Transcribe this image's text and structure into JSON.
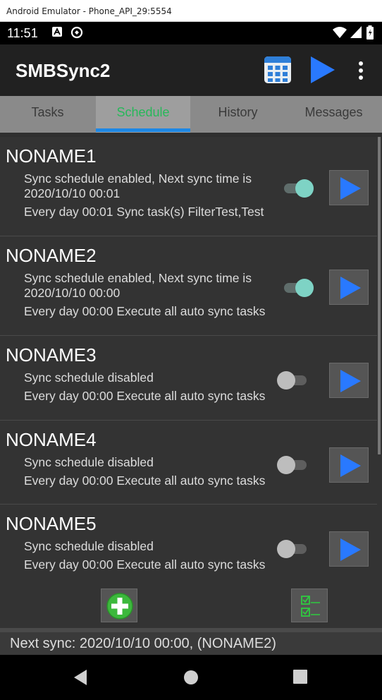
{
  "window": {
    "title": "Android Emulator - Phone_API_29:5554"
  },
  "status_bar": {
    "time": "11:51"
  },
  "app_bar": {
    "title": "SMBSync2"
  },
  "tabs": [
    {
      "label": "Tasks",
      "active": false
    },
    {
      "label": "Schedule",
      "active": true
    },
    {
      "label": "History",
      "active": false
    },
    {
      "label": "Messages",
      "active": false
    }
  ],
  "schedules": [
    {
      "name": "NONAME1",
      "status": "Sync schedule enabled, Next sync time is 2020/10/10 00:01",
      "detail": "Every day 00:01 Sync task(s) FilterTest,Test",
      "enabled": true
    },
    {
      "name": "NONAME2",
      "status": "Sync schedule enabled, Next sync time is 2020/10/10 00:00",
      "detail": "Every day 00:00 Execute all auto sync tasks",
      "enabled": true
    },
    {
      "name": "NONAME3",
      "status": "Sync schedule disabled",
      "detail": "Every day 00:00 Execute all auto sync tasks",
      "enabled": false
    },
    {
      "name": "NONAME4",
      "status": "Sync schedule disabled",
      "detail": "Every day 00:00 Execute all auto sync tasks",
      "enabled": false
    },
    {
      "name": "NONAME5",
      "status": "Sync schedule disabled",
      "detail": "Every day 00:00 Execute all auto sync tasks",
      "enabled": false
    }
  ],
  "footer": {
    "next_sync": "Next sync: 2020/10/10 00:00, (NONAME2)"
  },
  "colors": {
    "accent_green": "#27b85a",
    "tab_indicator": "#1e88e5",
    "play_blue": "#2979ff",
    "toggle_on": "#7ed3c5"
  }
}
